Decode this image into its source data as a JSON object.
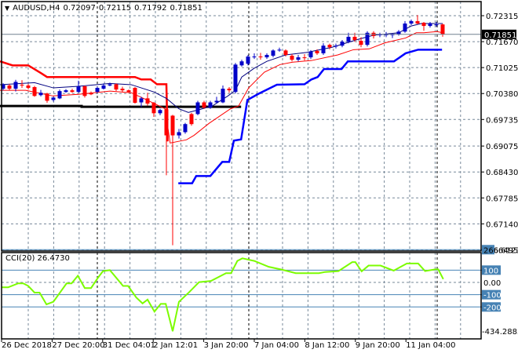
{
  "header": {
    "symbol": "AUDUSD,H4",
    "open": "0.72097",
    "high": "0.72115",
    "low": "0.71792",
    "close": "0.71851",
    "dropdown_icon": "triangle-down-icon"
  },
  "cci_header": {
    "name": "CCI(20)",
    "value": "26.4730"
  },
  "colors": {
    "bull": "#0000c8",
    "bear": "#ff0000",
    "ma_fast": "#000080",
    "ma_slow": "#ff0000",
    "upper_band": "#ff0000",
    "lower_band": "#0000ff",
    "cci": "#7cfc00",
    "cci_levels": "#4682b4",
    "grid": "#778899"
  },
  "price_axis": {
    "labels": [
      "0.72315",
      "0.71670",
      "0.71025",
      "0.70380",
      "0.69735",
      "0.69075",
      "0.68430",
      "0.67785",
      "0.67140",
      "0.66495"
    ],
    "current": "0.71851"
  },
  "cci_axis": {
    "max_label": "266.6123",
    "labels": [
      {
        "v": 100,
        "t": "100",
        "boxed": true
      },
      {
        "v": 0,
        "t": "0.00",
        "boxed": false
      },
      {
        "v": -100,
        "t": "-100",
        "boxed": true
      },
      {
        "v": -200,
        "t": "-200",
        "boxed": true
      }
    ],
    "min_label": "-434.2883",
    "levels": [
      266.6,
      100,
      -100,
      -200
    ]
  },
  "time_axis": [
    "26 Dec 2018",
    "27 Dec 20:00",
    "31 Dec 04:01",
    "2 Jan 12:01",
    "3 Jan 20:00",
    "7 Jan 04:00",
    "8 Jan 12:00",
    "9 Jan 20:00",
    "11 Jan 04:00"
  ],
  "chart_data": {
    "type": "candlestick",
    "candles_ohlc": [
      [
        0.705,
        0.7064,
        0.7046,
        0.706
      ],
      [
        0.7058,
        0.7062,
        0.7046,
        0.705
      ],
      [
        0.705,
        0.7072,
        0.7043,
        0.7067
      ],
      [
        0.706,
        0.7071,
        0.7052,
        0.7058
      ],
      [
        0.7058,
        0.7062,
        0.7048,
        0.7052
      ],
      [
        0.7054,
        0.7057,
        0.703,
        0.7032
      ],
      [
        0.7034,
        0.7047,
        0.7031,
        0.704
      ],
      [
        0.7038,
        0.704,
        0.7015,
        0.702
      ],
      [
        0.7022,
        0.703,
        0.7018,
        0.7028
      ],
      [
        0.7026,
        0.7048,
        0.7024,
        0.7044
      ],
      [
        0.7042,
        0.7049,
        0.704,
        0.7046
      ],
      [
        0.7046,
        0.705,
        0.704,
        0.7042
      ],
      [
        0.7042,
        0.707,
        0.704,
        0.7056
      ],
      [
        0.7056,
        0.7058,
        0.7028,
        0.7032
      ],
      [
        0.704,
        0.7043,
        0.7034,
        0.7036
      ],
      [
        0.7042,
        0.7055,
        0.704,
        0.7052
      ],
      [
        0.705,
        0.7063,
        0.7048,
        0.7058
      ],
      [
        0.7058,
        0.7065,
        0.7056,
        0.7061
      ],
      [
        0.7061,
        0.7063,
        0.7044,
        0.7048
      ],
      [
        0.705,
        0.7055,
        0.7042,
        0.7046
      ],
      [
        0.7046,
        0.7048,
        0.704,
        0.7042
      ],
      [
        0.7052,
        0.7054,
        0.7013,
        0.7015
      ],
      [
        0.7016,
        0.703,
        0.7004,
        0.7026
      ],
      [
        0.7026,
        0.704,
        0.7008,
        0.7013
      ],
      [
        0.7015,
        0.7017,
        0.698,
        0.6989
      ],
      [
        0.6989,
        0.7,
        0.6984,
        0.6997
      ],
      [
        0.6999,
        0.7001,
        0.6835,
        0.6934
      ],
      [
        0.6983,
        0.6985,
        0.6661,
        0.6934
      ],
      [
        0.6934,
        0.695,
        0.6926,
        0.6942
      ],
      [
        0.6942,
        0.6965,
        0.6938,
        0.6962
      ],
      [
        0.6987,
        0.699,
        0.6958,
        0.6962
      ],
      [
        0.6987,
        0.702,
        0.6984,
        0.7016
      ],
      [
        0.7016,
        0.702,
        0.7,
        0.7003
      ],
      [
        0.7003,
        0.702,
        0.7,
        0.7016
      ],
      [
        0.7016,
        0.703,
        0.7014,
        0.702
      ],
      [
        0.7016,
        0.7058,
        0.7014,
        0.705
      ],
      [
        0.705,
        0.7054,
        0.704,
        0.7046
      ],
      [
        0.7042,
        0.7114,
        0.7038,
        0.711
      ],
      [
        0.7108,
        0.7122,
        0.7105,
        0.7118
      ],
      [
        0.7112,
        0.7134,
        0.7108,
        0.713
      ],
      [
        0.7128,
        0.7138,
        0.7124,
        0.713
      ],
      [
        0.713,
        0.7139,
        0.7122,
        0.7128
      ],
      [
        0.7128,
        0.7138,
        0.7124,
        0.7134
      ],
      [
        0.7132,
        0.7148,
        0.7128,
        0.7145
      ],
      [
        0.7145,
        0.7152,
        0.7142,
        0.7147
      ],
      [
        0.7145,
        0.7148,
        0.713,
        0.7134
      ],
      [
        0.7132,
        0.7136,
        0.7118,
        0.7122
      ],
      [
        0.7122,
        0.7134,
        0.7118,
        0.7128
      ],
      [
        0.7128,
        0.7136,
        0.712,
        0.7126
      ],
      [
        0.7128,
        0.7146,
        0.7124,
        0.7142
      ],
      [
        0.7144,
        0.7148,
        0.7134,
        0.7138
      ],
      [
        0.7138,
        0.7163,
        0.7134,
        0.7157
      ],
      [
        0.7159,
        0.7162,
        0.7148,
        0.7153
      ],
      [
        0.7155,
        0.7162,
        0.715,
        0.7157
      ],
      [
        0.7157,
        0.7171,
        0.7153,
        0.7167
      ],
      [
        0.7167,
        0.7189,
        0.7163,
        0.7179
      ],
      [
        0.7179,
        0.7189,
        0.7167,
        0.7171
      ],
      [
        0.7169,
        0.7178,
        0.7153,
        0.7159
      ],
      [
        0.7159,
        0.7193,
        0.7155,
        0.7189
      ],
      [
        0.7189,
        0.7193,
        0.7175,
        0.7181
      ],
      [
        0.7183,
        0.7189,
        0.7178,
        0.7185
      ],
      [
        0.7183,
        0.7191,
        0.7178,
        0.7185
      ],
      [
        0.7184,
        0.7188,
        0.7176,
        0.7185
      ],
      [
        0.7185,
        0.7196,
        0.7182,
        0.7192
      ],
      [
        0.7192,
        0.7218,
        0.7189,
        0.7212
      ],
      [
        0.7212,
        0.7222,
        0.7208,
        0.7218
      ],
      [
        0.7218,
        0.7233,
        0.721,
        0.7212
      ],
      [
        0.7214,
        0.7216,
        0.7194,
        0.7206
      ],
      [
        0.7206,
        0.7216,
        0.7202,
        0.7212
      ],
      [
        0.7208,
        0.7216,
        0.7204,
        0.721
      ],
      [
        0.72097,
        0.72115,
        0.71792,
        0.71851
      ]
    ],
    "ma_fast": [
      [
        -0.5,
        0.706
      ],
      [
        5,
        0.7065
      ],
      [
        8,
        0.7052
      ],
      [
        12,
        0.7056
      ],
      [
        17,
        0.7063
      ],
      [
        20.4,
        0.706
      ],
      [
        24,
        0.7042
      ],
      [
        26,
        0.7026
      ],
      [
        28,
        0.7
      ],
      [
        29.5,
        0.6991
      ],
      [
        31,
        0.6997
      ],
      [
        33.3,
        0.7007
      ],
      [
        35.8,
        0.7032
      ],
      [
        37,
        0.7046
      ],
      [
        38,
        0.7079
      ],
      [
        40,
        0.7101
      ],
      [
        42,
        0.7118
      ],
      [
        45,
        0.7134
      ],
      [
        48.3,
        0.714
      ],
      [
        52.4,
        0.7153
      ],
      [
        56.6,
        0.7173
      ],
      [
        59,
        0.7183
      ],
      [
        63,
        0.7189
      ],
      [
        65,
        0.7206
      ],
      [
        66.6,
        0.7212
      ],
      [
        70,
        0.7212
      ]
    ],
    "ma_slow": [
      [
        -0.5,
        0.7046
      ],
      [
        3.6,
        0.7046
      ],
      [
        7.9,
        0.7032
      ],
      [
        12,
        0.7036
      ],
      [
        17,
        0.7044
      ],
      [
        20.4,
        0.704
      ],
      [
        22.9,
        0.7022
      ],
      [
        25.8,
        0.7
      ],
      [
        26.6,
        0.6915
      ],
      [
        29.2,
        0.6923
      ],
      [
        30.4,
        0.6934
      ],
      [
        32.8,
        0.6964
      ],
      [
        36.2,
        0.7
      ],
      [
        37.5,
        0.7007
      ],
      [
        39.1,
        0.7052
      ],
      [
        41.6,
        0.7091
      ],
      [
        44.1,
        0.711
      ],
      [
        46.1,
        0.7116
      ],
      [
        49.1,
        0.712
      ],
      [
        53.3,
        0.7134
      ],
      [
        55.8,
        0.7147
      ],
      [
        58.3,
        0.7149
      ],
      [
        60.8,
        0.7164
      ],
      [
        64.1,
        0.7176
      ],
      [
        65.8,
        0.7189
      ],
      [
        67,
        0.7189
      ],
      [
        69.1,
        0.7192
      ],
      [
        70,
        0.7189
      ]
    ],
    "upper_band": [
      [
        -0.5,
        0.7118
      ],
      [
        1.5,
        0.7108
      ],
      [
        4,
        0.7108
      ],
      [
        6,
        0.7089
      ],
      [
        7,
        0.7079
      ],
      [
        21,
        0.7079
      ],
      [
        22,
        0.7073
      ],
      [
        23.5,
        0.7073
      ],
      [
        24.5,
        0.7061
      ],
      [
        26,
        0.7061
      ],
      [
        26.2,
        0.6919
      ]
    ],
    "lower_band": [
      [
        27.9,
        0.6815
      ],
      [
        30.1,
        0.6815
      ],
      [
        30.75,
        0.6833
      ],
      [
        33,
        0.6833
      ],
      [
        34.9,
        0.6868
      ],
      [
        36,
        0.6868
      ],
      [
        36.75,
        0.6921
      ],
      [
        37.9,
        0.6924
      ],
      [
        38.9,
        0.7022
      ],
      [
        40.75,
        0.7038
      ],
      [
        43.6,
        0.706
      ],
      [
        48,
        0.7061
      ],
      [
        49.1,
        0.7073
      ],
      [
        50.1,
        0.7079
      ],
      [
        51.1,
        0.7099
      ],
      [
        53.9,
        0.7099
      ],
      [
        54.9,
        0.7118
      ],
      [
        62.25,
        0.7118
      ],
      [
        64.1,
        0.7138
      ],
      [
        66.1,
        0.7147
      ],
      [
        69.9,
        0.7147
      ]
    ],
    "support_line": [
      [
        -0.5,
        0.7007
      ],
      [
        12.5,
        0.7007
      ],
      [
        12.5,
        0.7005
      ],
      [
        37.9,
        0.7005
      ]
    ],
    "cci": [
      [
        -0.2,
        -40
      ],
      [
        0.8,
        -40
      ],
      [
        2.4,
        -8
      ],
      [
        3.2,
        -8
      ],
      [
        4,
        -29
      ],
      [
        5,
        -83
      ],
      [
        5.8,
        -83
      ],
      [
        6.9,
        -179
      ],
      [
        8,
        -158
      ],
      [
        10.1,
        -8
      ],
      [
        10.9,
        -8
      ],
      [
        11.9,
        54
      ],
      [
        13,
        -46
      ],
      [
        14,
        -46
      ],
      [
        15.1,
        38
      ],
      [
        15.9,
        92
      ],
      [
        17,
        100
      ],
      [
        19.1,
        -29
      ],
      [
        19.9,
        -29
      ],
      [
        21.2,
        -123
      ],
      [
        22.2,
        -171
      ],
      [
        23,
        -140
      ],
      [
        24.1,
        -238
      ],
      [
        25.1,
        -175
      ],
      [
        25.9,
        -175
      ],
      [
        27,
        -398
      ],
      [
        28,
        -158
      ],
      [
        29.6,
        -81
      ],
      [
        31.2,
        2
      ],
      [
        33.1,
        12
      ],
      [
        35.5,
        75
      ],
      [
        36.3,
        75
      ],
      [
        37.3,
        175
      ],
      [
        38.1,
        196
      ],
      [
        40,
        175
      ],
      [
        42.3,
        127
      ],
      [
        44.2,
        106
      ],
      [
        46.6,
        75
      ],
      [
        50.3,
        75
      ],
      [
        51.3,
        85
      ],
      [
        53.4,
        92
      ],
      [
        55.6,
        165
      ],
      [
        56.1,
        165
      ],
      [
        57.1,
        90
      ],
      [
        58.2,
        137
      ],
      [
        60.1,
        137
      ],
      [
        62.2,
        96
      ],
      [
        64.3,
        154
      ],
      [
        66.1,
        154
      ],
      [
        67.2,
        92
      ],
      [
        68.8,
        106
      ],
      [
        69.3,
        106
      ],
      [
        70.1,
        26.5
      ]
    ],
    "price_range": [
      0.66495,
      0.72315
    ],
    "cci_range": [
      -434.2883,
      266.6123
    ]
  }
}
